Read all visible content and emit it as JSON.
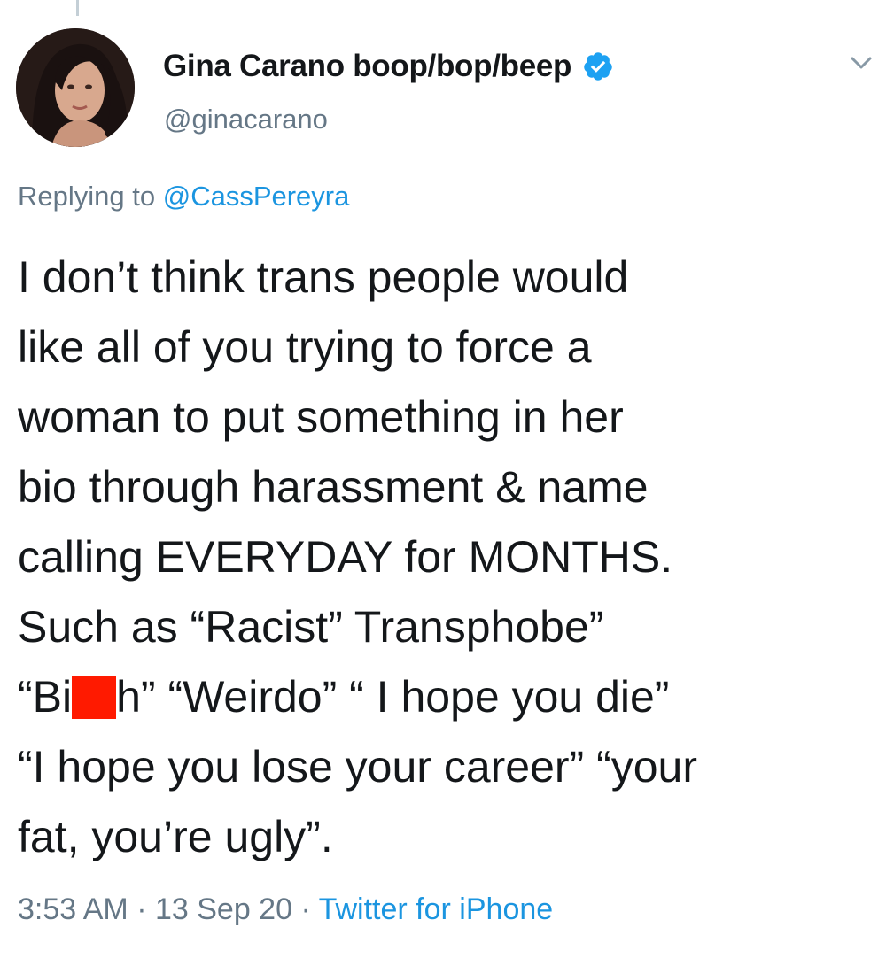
{
  "author": {
    "display_name": "Gina Carano boop/bop/beep",
    "handle": "@ginacarano",
    "verified": true
  },
  "reply": {
    "prefix": "Replying to ",
    "mention": "@CassPereyra"
  },
  "tweet_lines": [
    "I don’t think trans people would",
    "like all of you trying to force a",
    "woman to put something in her",
    "bio through harassment & name",
    "calling EVERYDAY for MONTHS.",
    "Such as “Racist” Transphobe”"
  ],
  "tweet_line7": {
    "before": "“Bi",
    "after": "h” “Weirdo” “ I hope you die”"
  },
  "tweet_lines_end": [
    "“I hope you lose your career” “your",
    "fat, you’re ugly”."
  ],
  "meta": {
    "time": "3:53 AM",
    "sep1": " · ",
    "date": "13 Sep 20",
    "sep2": " · ",
    "source": "Twitter for iPhone"
  },
  "colors": {
    "accent": "#1b95e0",
    "secondary_text": "#657786",
    "redaction": "#ff1a00"
  }
}
